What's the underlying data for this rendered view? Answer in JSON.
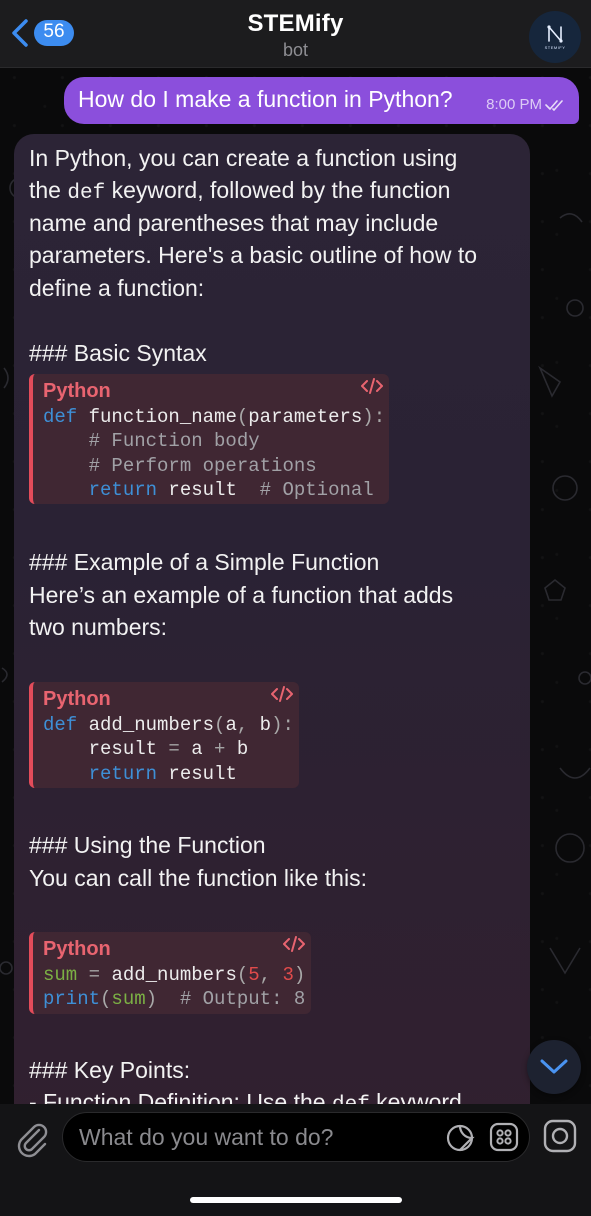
{
  "header": {
    "back_badge": "56",
    "title": "STEMify",
    "subtitle": "bot",
    "avatar_text": "STEMIFY"
  },
  "outgoing": {
    "text": "How do I make a function in Python?",
    "time": "8:00 PM"
  },
  "reply": {
    "intro": [
      "In Python, you can create a function using",
      "parameters. Here's a basic outline of how to",
      "define a function:"
    ],
    "intro_line2_pre": "the ",
    "intro_line2_code": "def",
    "intro_line2_post": " keyword, followed by the function",
    "intro_line3": "name and parentheses that may include",
    "heading_syntax": "### Basic Syntax",
    "code1": {
      "lang": "Python",
      "l1_kw": "def",
      "l1_name": " function_name",
      "l1_p1": "(",
      "l1_param": "parameters",
      "l1_p2": "):",
      "l2": "    # Function body",
      "l3": "    # Perform operations",
      "l4_kw": "return",
      "l4_val": " result",
      "l4_cm": "  # Optional"
    },
    "heading_example": "### Example of a Simple Function",
    "example_text_1": "Here’s an example of a function that adds",
    "example_text_2": "two numbers:",
    "code2": {
      "lang": "Python",
      "l1_kw": "def",
      "l1_name": " add_numbers",
      "l1_p1": "(",
      "l1_a": "a",
      "l1_comma": ", ",
      "l1_b": "b",
      "l1_p2": "):",
      "l2_indent": "    result ",
      "l2_eq": "=",
      "l2_a": " a ",
      "l2_plus": "+",
      "l2_b": " b",
      "l3_kw": "return",
      "l3_val": " result"
    },
    "heading_using": "### Using the Function",
    "using_text": "You can call the function like this:",
    "code3": {
      "lang": "Python",
      "l1_var": "sum",
      "l1_eq": " = ",
      "l1_fn": "add_numbers",
      "l1_p1": "(",
      "l1_n1": "5",
      "l1_comma": ", ",
      "l1_n2": "3",
      "l1_p2": ")",
      "l2_fn": "print",
      "l2_p1": "(",
      "l2_var": "sum",
      "l2_p2": ")",
      "l2_cm": "  # Output: 8"
    },
    "heading_key": "### Key Points:",
    "key_line_pre": "- Function Definition: Use the ",
    "key_line_code": "def",
    "key_line_post": " keyword"
  },
  "input": {
    "placeholder": "What do you want to do?"
  },
  "colors": {
    "outgoing_bubble": "#8b4fdc",
    "badge": "#3c8cf0",
    "code_accent": "#e34c5a",
    "keyword": "#3e8fd6"
  }
}
